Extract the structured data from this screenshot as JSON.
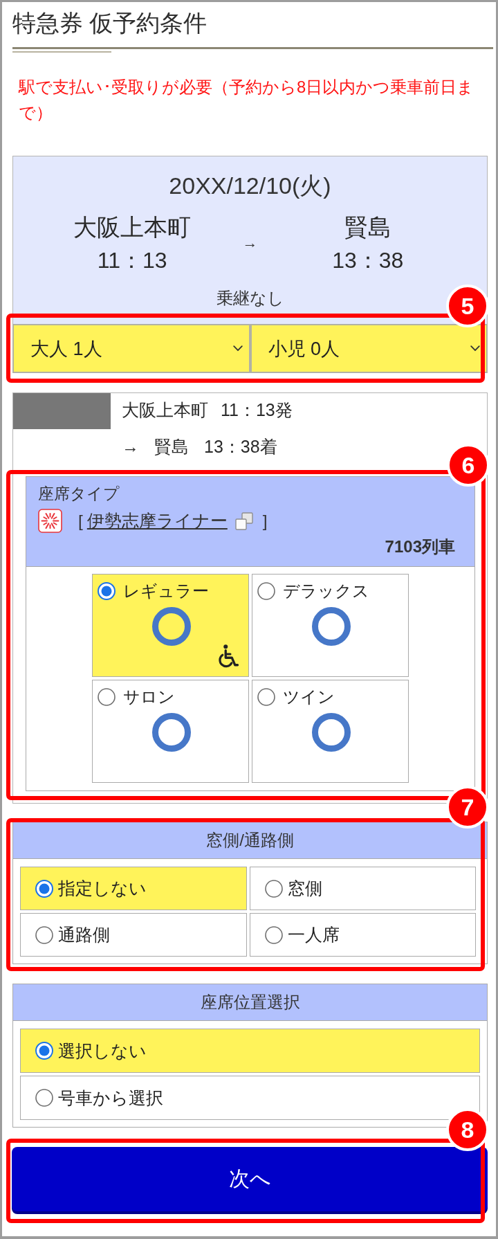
{
  "page": {
    "title": "特急券 仮予約条件",
    "notice": "駅で支払い･受取りが必要（予約から8日以内かつ乗車前日まで）"
  },
  "journey": {
    "date": "20XX/12/10(火)",
    "departure": {
      "station": "大阪上本町",
      "time": "11：13"
    },
    "arrow": "→",
    "arrival": {
      "station": "賢島",
      "time": "13：38"
    },
    "transfer": "乗継なし"
  },
  "passengers": {
    "callout": "5",
    "selects": [
      {
        "value": "大人 1人"
      },
      {
        "value": "小児 0人"
      }
    ]
  },
  "train": {
    "departure": {
      "station": "大阪上本町",
      "time": "11：13発"
    },
    "arrival": {
      "arrow": "→",
      "station": "賢島",
      "time": "13：38着"
    }
  },
  "seat_type": {
    "callout": "6",
    "title": "座席タイプ",
    "open_bracket": "[",
    "train_name": "伊勢志摩ライナー",
    "close_bracket": "]",
    "train_number": "7103列車",
    "options": [
      {
        "label": "レギュラー",
        "selected": true,
        "available": true,
        "wheelchair": true
      },
      {
        "label": "デラックス",
        "selected": false,
        "available": true,
        "wheelchair": false
      },
      {
        "label": "サロン",
        "selected": false,
        "available": true,
        "wheelchair": false
      },
      {
        "label": "ツイン",
        "selected": false,
        "available": true,
        "wheelchair": false
      }
    ]
  },
  "window_aisle": {
    "callout": "7",
    "title": "窓側/通路側",
    "options": [
      {
        "label": "指定しない",
        "selected": true
      },
      {
        "label": "窓側",
        "selected": false
      },
      {
        "label": "通路側",
        "selected": false
      },
      {
        "label": "一人席",
        "selected": false
      }
    ]
  },
  "seat_position": {
    "title": "座席位置選択",
    "options": [
      {
        "label": "選択しない",
        "selected": true
      },
      {
        "label": "号車から選択",
        "selected": false
      }
    ]
  },
  "next_button": {
    "callout": "8",
    "label": "次へ"
  }
}
